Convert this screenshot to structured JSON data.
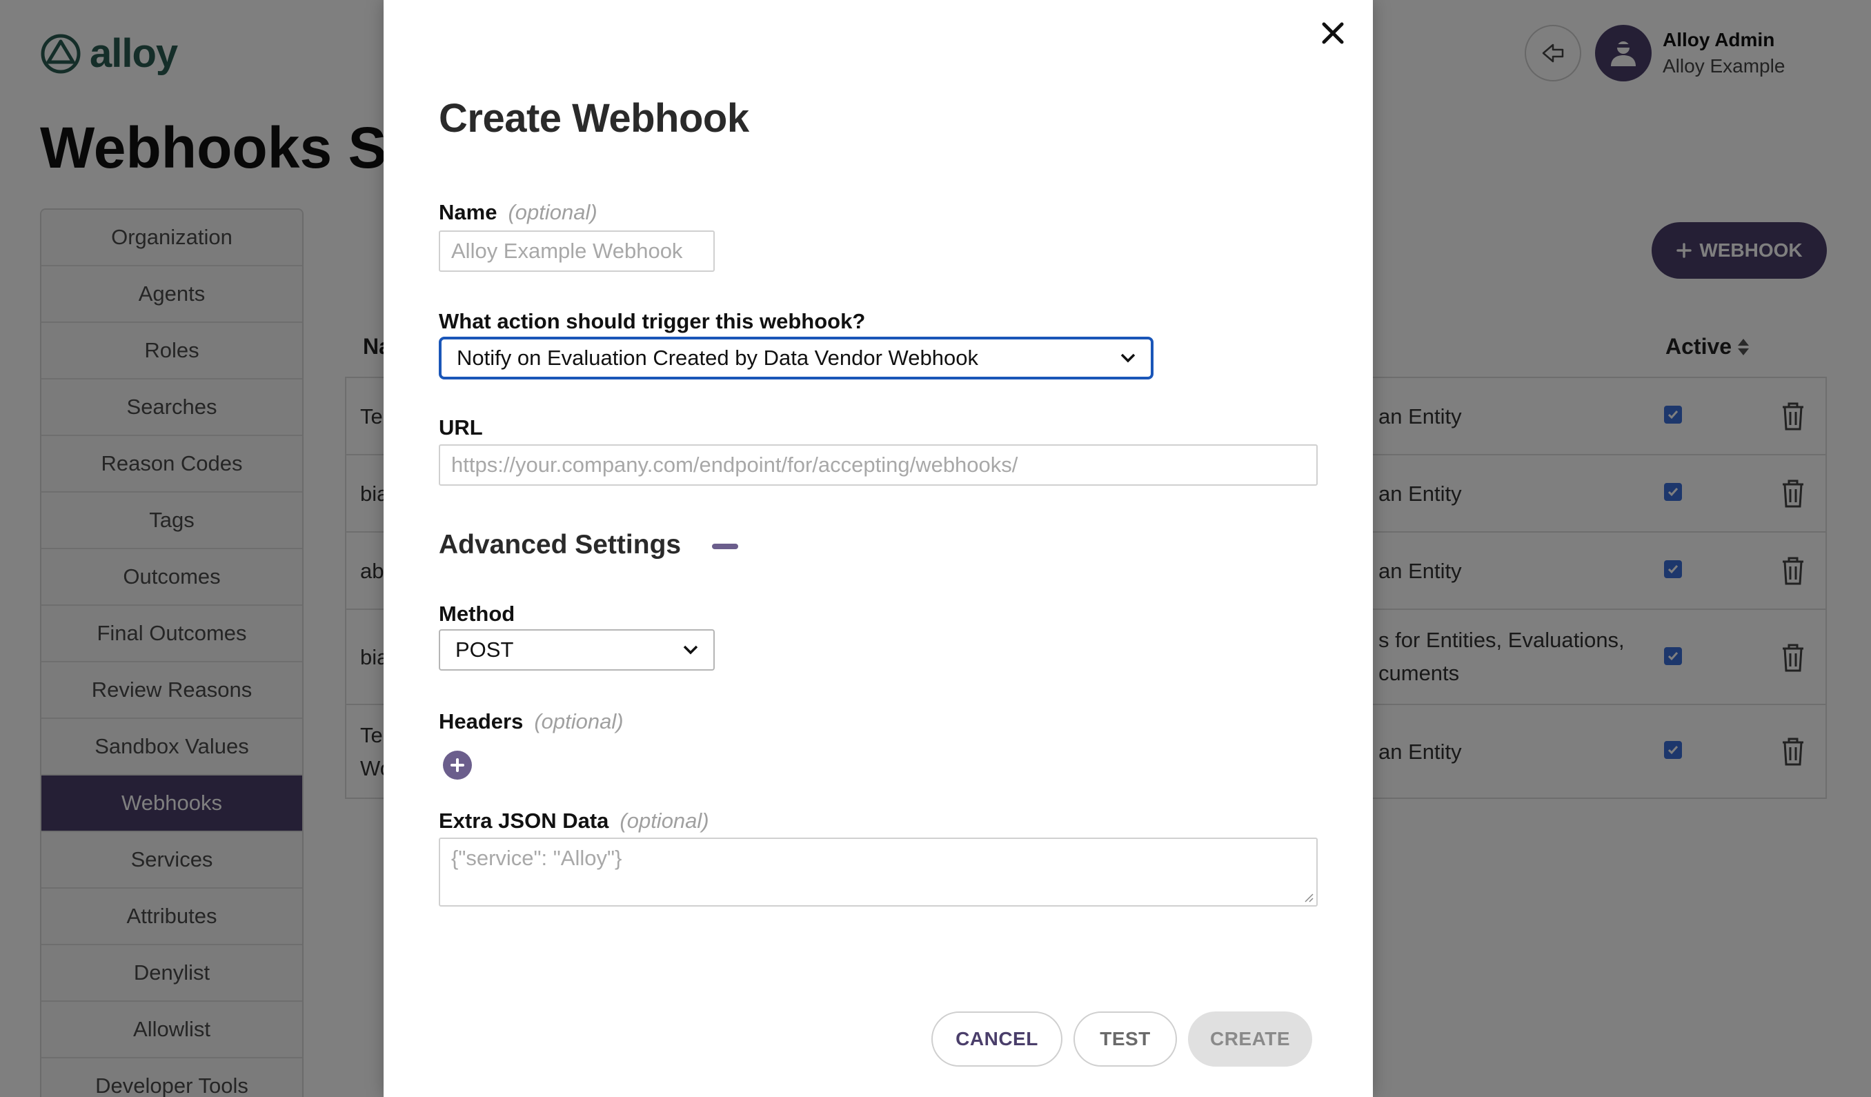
{
  "app": {
    "logo_text": "alloy",
    "page_title": "Webhooks Settings",
    "user": {
      "name": "Alloy Admin",
      "org": "Alloy Example"
    },
    "add_webhook_label": "WEBHOOK",
    "sidebar": {
      "items": [
        {
          "label": "Organization",
          "active": false
        },
        {
          "label": "Agents",
          "active": false
        },
        {
          "label": "Roles",
          "active": false
        },
        {
          "label": "Searches",
          "active": false
        },
        {
          "label": "Reason Codes",
          "active": false
        },
        {
          "label": "Tags",
          "active": false
        },
        {
          "label": "Outcomes",
          "active": false
        },
        {
          "label": "Final Outcomes",
          "active": false
        },
        {
          "label": "Review Reasons",
          "active": false
        },
        {
          "label": "Sandbox Values",
          "active": false
        },
        {
          "label": "Webhooks",
          "active": true
        },
        {
          "label": "Services",
          "active": false
        },
        {
          "label": "Attributes",
          "active": false
        },
        {
          "label": "Denylist",
          "active": false
        },
        {
          "label": "Allowlist",
          "active": false
        },
        {
          "label": "Developer Tools",
          "active": false
        }
      ]
    },
    "table": {
      "col_name": "Na",
      "col_active": "Active",
      "rows": [
        {
          "name": "Te",
          "trigger": "an Entity",
          "active": true
        },
        {
          "name": "bia",
          "trigger": "an Entity",
          "active": true
        },
        {
          "name": "ab",
          "trigger": "an Entity",
          "active": true
        },
        {
          "name": "bia",
          "trigger": "s for Entities, Evaluations, cuments",
          "active": true
        },
        {
          "name": "Te Wo",
          "trigger": "an Entity",
          "active": true
        }
      ]
    }
  },
  "modal": {
    "title": "Create Webhook",
    "name_label": "Name",
    "optional": "(optional)",
    "name_placeholder": "Alloy Example Webhook",
    "trigger_label": "What action should trigger this webhook?",
    "trigger_value": "Notify on Evaluation Created by Data Vendor Webhook",
    "url_label": "URL",
    "url_placeholder": "https://your.company.com/endpoint/for/accepting/webhooks/",
    "advanced_title": "Advanced Settings",
    "method_label": "Method",
    "method_value": "POST",
    "headers_label": "Headers",
    "extra_json_label": "Extra JSON Data",
    "extra_json_placeholder": "{\"service\": \"Alloy\"}",
    "cancel_label": "CANCEL",
    "test_label": "TEST",
    "create_label": "CREATE"
  },
  "colors": {
    "brand_purple": "#4a3e6a",
    "accent_purple": "#6b5e8c",
    "logo_green": "#2b5d52",
    "focus_blue": "#1a56b8"
  },
  "icons": [
    "alloy-logo-icon",
    "back-arrow-icon",
    "user-avatar-icon",
    "plus-icon",
    "sort-icon",
    "checkbox-checked-icon",
    "trash-icon",
    "close-icon",
    "chevron-down-icon",
    "minus-icon",
    "plus-circle-icon"
  ]
}
